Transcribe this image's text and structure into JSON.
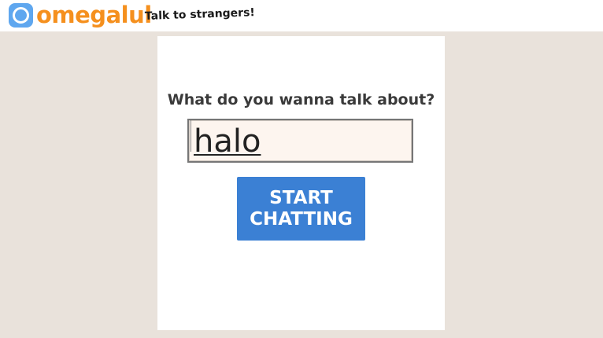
{
  "header": {
    "logo_text": "omegalul",
    "tagline": "Talk to strangers!",
    "logo_icon": "circle-logo-icon",
    "brand_color": "#f5901e",
    "logo_icon_color": "#5fa7ef"
  },
  "main": {
    "question": "What do you wanna talk about?",
    "topic_value": "halo",
    "start_button_line1": "START",
    "start_button_line2": "CHATTING",
    "button_color": "#3b80d4",
    "page_background": "#e9e2db"
  }
}
